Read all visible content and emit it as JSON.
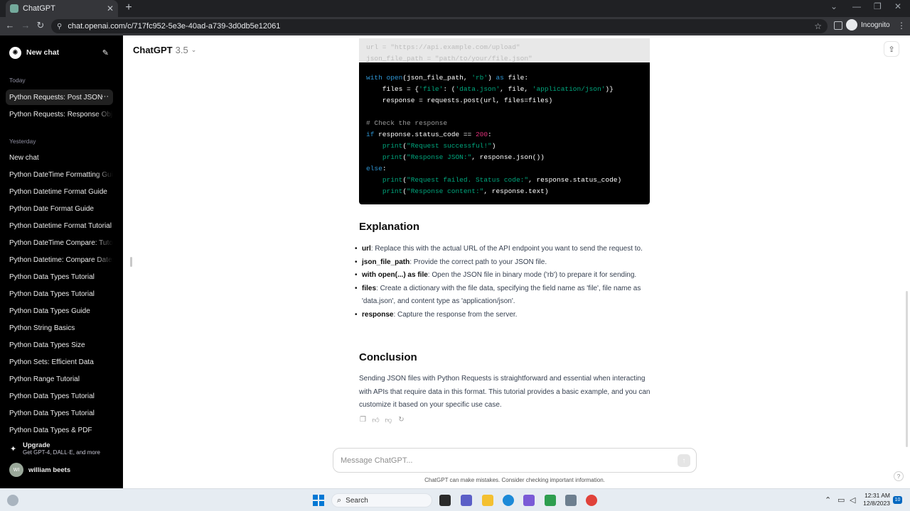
{
  "browser": {
    "tab_title": "ChatGPT",
    "url": "chat.openai.com/c/717fc952-5e3e-40ad-a739-3d0db5e12061",
    "incognito_label": "Incognito"
  },
  "sidebar": {
    "new_chat_label": "New chat",
    "today_label": "Today",
    "yesterday_label": "Yesterday",
    "today_items": [
      "Python Requests: Post JSON",
      "Python Requests: Response Obje"
    ],
    "yesterday_items": [
      "New chat",
      "Python DateTime Formatting Gui",
      "Python Datetime Format Guide",
      "Python Date Format Guide",
      "Python Datetime Format Tutorial",
      "Python DateTime Compare: Tutor",
      "Python Datetime: Compare Dates",
      "Python Data Types Tutorial",
      "Python Data Types Tutorial",
      "Python Data Types Guide",
      "Python String Basics",
      "Python Data Types Size",
      "Python Sets: Efficient Data",
      "Python Range Tutorial",
      "Python Data Types Tutorial",
      "Python Data Types Tutorial",
      "Python Data Types & PDF"
    ],
    "upgrade_title": "Upgrade",
    "upgrade_sub": "Get GPT-4, DALL·E, and more",
    "user_initials": "WI",
    "user_name": "william beets"
  },
  "header": {
    "model_name": "ChatGPT",
    "model_version": "3.5"
  },
  "code": {
    "faded_lines": [
      "url = \"https://api.example.com/upload\"",
      "json_file_path = \"path/to/your/file.json\""
    ],
    "l1_a": "with ",
    "l1_b": "open",
    "l1_c": "(json_file_path, ",
    "l1_d": "'rb'",
    "l1_e": ") ",
    "l1_f": "as",
    "l1_g": " file:",
    "l2_a": "    files = {",
    "l2_b": "'file'",
    "l2_c": ": (",
    "l2_d": "'data.json'",
    "l2_e": ", file, ",
    "l2_f": "'application/json'",
    "l2_g": ")}",
    "l3": "    response = requests.post(url, files=files)",
    "l4": "# Check the response",
    "l5_a": "if",
    "l5_b": " response.status_code == ",
    "l5_c": "200",
    "l5_d": ":",
    "l6_a": "    ",
    "l6_b": "print",
    "l6_c": "(",
    "l6_d": "\"Request successful!\"",
    "l6_e": ")",
    "l7_a": "    ",
    "l7_b": "print",
    "l7_c": "(",
    "l7_d": "\"Response JSON:\"",
    "l7_e": ", response.json())",
    "l8": "else",
    "l8_b": ":",
    "l9_a": "    ",
    "l9_b": "print",
    "l9_c": "(",
    "l9_d": "\"Request failed. Status code:\"",
    "l9_e": ", response.status_code)",
    "l10_a": "    ",
    "l10_b": "print",
    "l10_c": "(",
    "l10_d": "\"Response content:\"",
    "l10_e": ", response.text)"
  },
  "explanation": {
    "heading": "Explanation",
    "items": [
      {
        "term": "url",
        "text": ": Replace this with the actual URL of the API endpoint you want to send the request to."
      },
      {
        "term": "json_file_path",
        "text": ": Provide the correct path to your JSON file."
      },
      {
        "term": "with open(...) as file",
        "text": ": Open the JSON file in binary mode ('rb') to prepare it for sending."
      },
      {
        "term": "files",
        "text": ": Create a dictionary with the file data, specifying the field name as 'file', file name as 'data.json', and content type as 'application/json'."
      },
      {
        "term": "response",
        "text": ": Capture the response from the server."
      }
    ]
  },
  "conclusion": {
    "heading": "Conclusion",
    "text": "Sending JSON files with Python Requests is straightforward and essential when interacting with APIs that require data in this format. This tutorial provides a basic example, and you can customize it based on your specific use case."
  },
  "composer": {
    "placeholder": "Message ChatGPT...",
    "disclaimer": "ChatGPT can make mistakes. Consider checking important information.",
    "help": "?"
  },
  "taskbar": {
    "search_label": "Search",
    "time": "12:31 AM",
    "date": "12/8/2023",
    "notification_count": "10"
  },
  "colors": {
    "sidebar_bg": "#000000",
    "code_keyword": "#2e95d3",
    "code_string": "#00a67d",
    "code_number": "#df3079"
  }
}
